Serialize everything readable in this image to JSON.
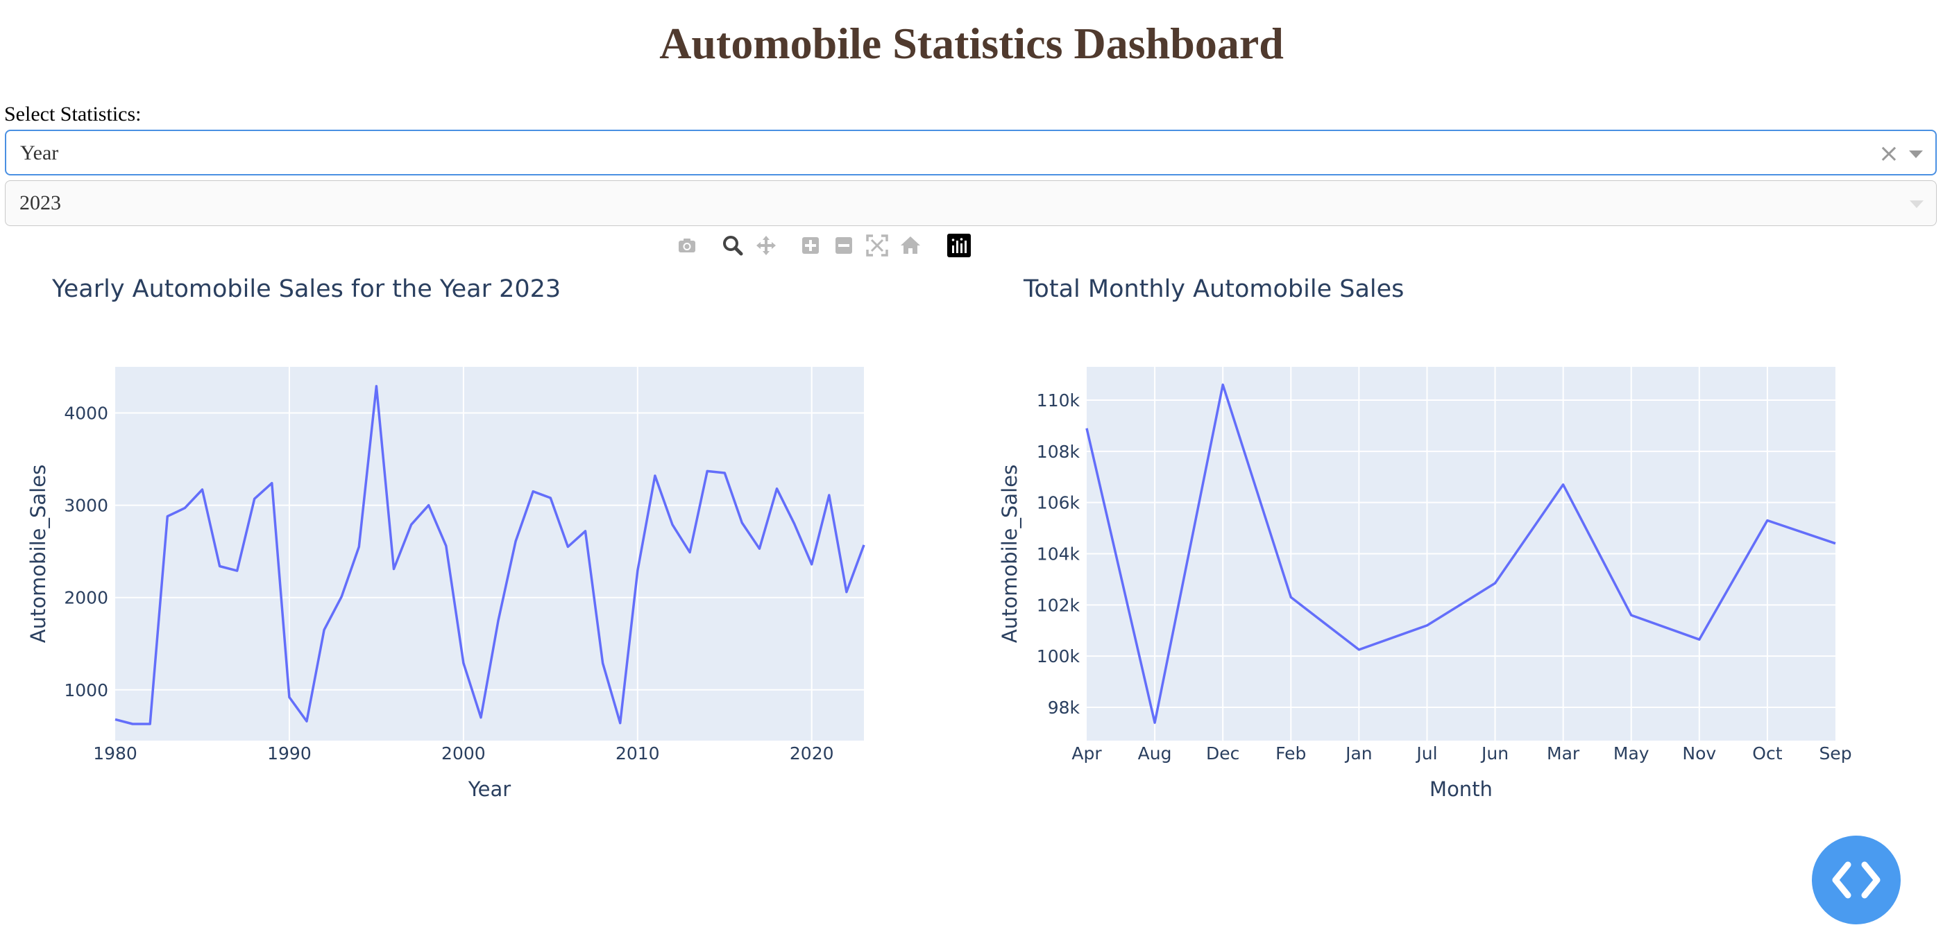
{
  "page": {
    "title": "Automobile Statistics Dashboard",
    "select_label": "Select Statistics:"
  },
  "controls": {
    "statistics_dropdown": {
      "value": "Year",
      "clear_glyph": "×"
    },
    "year_dropdown": {
      "value": "2023"
    }
  },
  "modebar": {
    "icons": [
      "camera-icon",
      "zoom-icon",
      "pan-icon",
      "zoom-in-icon",
      "zoom-out-icon",
      "autoscale-icon",
      "reset-axes-icon",
      "plotly-logo-icon"
    ]
  },
  "colors": {
    "line": "#636EFA",
    "plot_bg": "#E5ECF6",
    "title": "#503A2E",
    "text": "#2a3f5f",
    "fab": "#4a9bf0"
  },
  "chart_data": [
    {
      "type": "line",
      "title": "Yearly Automobile Sales for the Year 2023",
      "xlabel": "Year",
      "ylabel": "Automobile_Sales",
      "xlim": [
        1980,
        2023
      ],
      "ylim": [
        450,
        4500
      ],
      "xticks": [
        1980,
        1990,
        2000,
        2010,
        2020
      ],
      "yticks": [
        1000,
        2000,
        3000,
        4000
      ],
      "grid": true,
      "x": [
        1980,
        1981,
        1982,
        1983,
        1984,
        1985,
        1986,
        1987,
        1988,
        1989,
        1990,
        1991,
        1992,
        1993,
        1994,
        1995,
        1996,
        1997,
        1998,
        1999,
        2000,
        2001,
        2002,
        2003,
        2004,
        2005,
        2006,
        2007,
        2008,
        2009,
        2010,
        2011,
        2012,
        2013,
        2014,
        2015,
        2016,
        2017,
        2018,
        2019,
        2020,
        2021,
        2022,
        2023
      ],
      "y": [
        680,
        630,
        630,
        2880,
        2970,
        3170,
        2340,
        2290,
        3070,
        3240,
        920,
        660,
        1650,
        2010,
        2550,
        4290,
        2310,
        2790,
        3000,
        2560,
        1290,
        700,
        1750,
        2610,
        3150,
        3080,
        2550,
        2720,
        1290,
        640,
        2290,
        3320,
        2790,
        2490,
        3370,
        3350,
        2810,
        2530,
        3180,
        2800,
        2360,
        3110,
        2060,
        2570
      ]
    },
    {
      "type": "line",
      "title": "Total Monthly Automobile Sales",
      "xlabel": "Month",
      "ylabel": "Automobile_Sales",
      "categories": [
        "Apr",
        "Aug",
        "Dec",
        "Feb",
        "Jan",
        "Jul",
        "Jun",
        "Mar",
        "May",
        "Nov",
        "Oct",
        "Sep"
      ],
      "values": [
        108900,
        97400,
        110600,
        102300,
        100250,
        101200,
        102850,
        106700,
        101600,
        100650,
        105300,
        104400
      ],
      "ylim": [
        96700,
        111300
      ],
      "yticks": [
        98000,
        100000,
        102000,
        104000,
        106000,
        108000,
        110000
      ],
      "ytick_labels": [
        "98k",
        "100k",
        "102k",
        "104k",
        "106k",
        "108k",
        "110k"
      ],
      "grid": true
    }
  ]
}
